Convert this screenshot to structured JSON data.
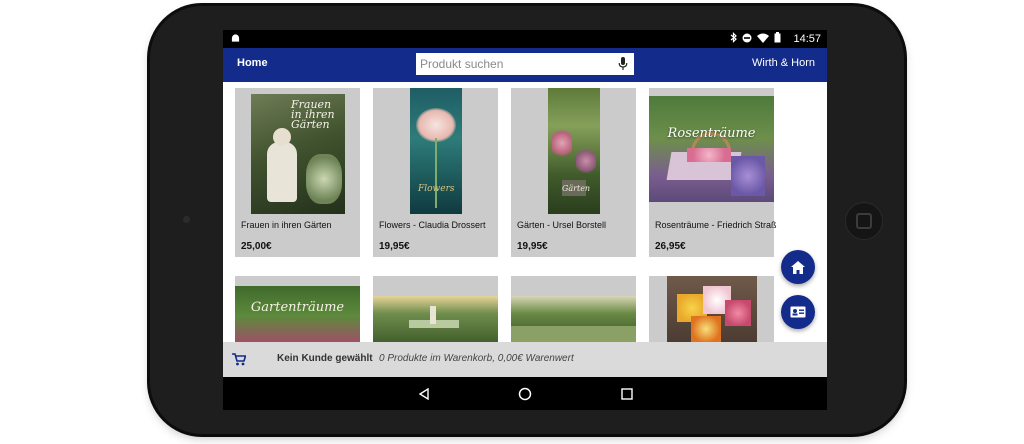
{
  "statusbar": {
    "time": "14:57"
  },
  "appbar": {
    "home_label": "Home",
    "search_placeholder": "Produkt suchen",
    "search_value": "",
    "brand": "Wirth & Horn",
    "accent_color": "#132b8a"
  },
  "products": [
    {
      "title": "Frauen in ihren Gärten",
      "price": "25,00€",
      "cover_text": "Frauen in ihren Gärten"
    },
    {
      "title": "Flowers - Claudia Drossert",
      "price": "19,95€",
      "cover_text": "Flowers"
    },
    {
      "title": "Gärten - Ursel Borstell",
      "price": "19,95€",
      "cover_text": "Gärten"
    },
    {
      "title": "Rosenträume - Friedrich Straß",
      "price": "26,95€",
      "cover_text": "Rosenträume"
    },
    {
      "title": "",
      "price": "",
      "cover_text": "Gartenträume"
    },
    {
      "title": "",
      "price": "",
      "cover_text": ""
    },
    {
      "title": "",
      "price": "",
      "cover_text": ""
    },
    {
      "title": "",
      "price": "",
      "cover_text": ""
    }
  ],
  "bottombar": {
    "customer": "Kein Kunde gewählt",
    "cart_info": "0 Produkte im Warenkorb, 0,00€ Warenwert"
  },
  "icons": {
    "home_fab": "home-icon",
    "customer_fab": "contact-card-icon",
    "cart": "cart-icon",
    "mic": "microphone-icon"
  }
}
